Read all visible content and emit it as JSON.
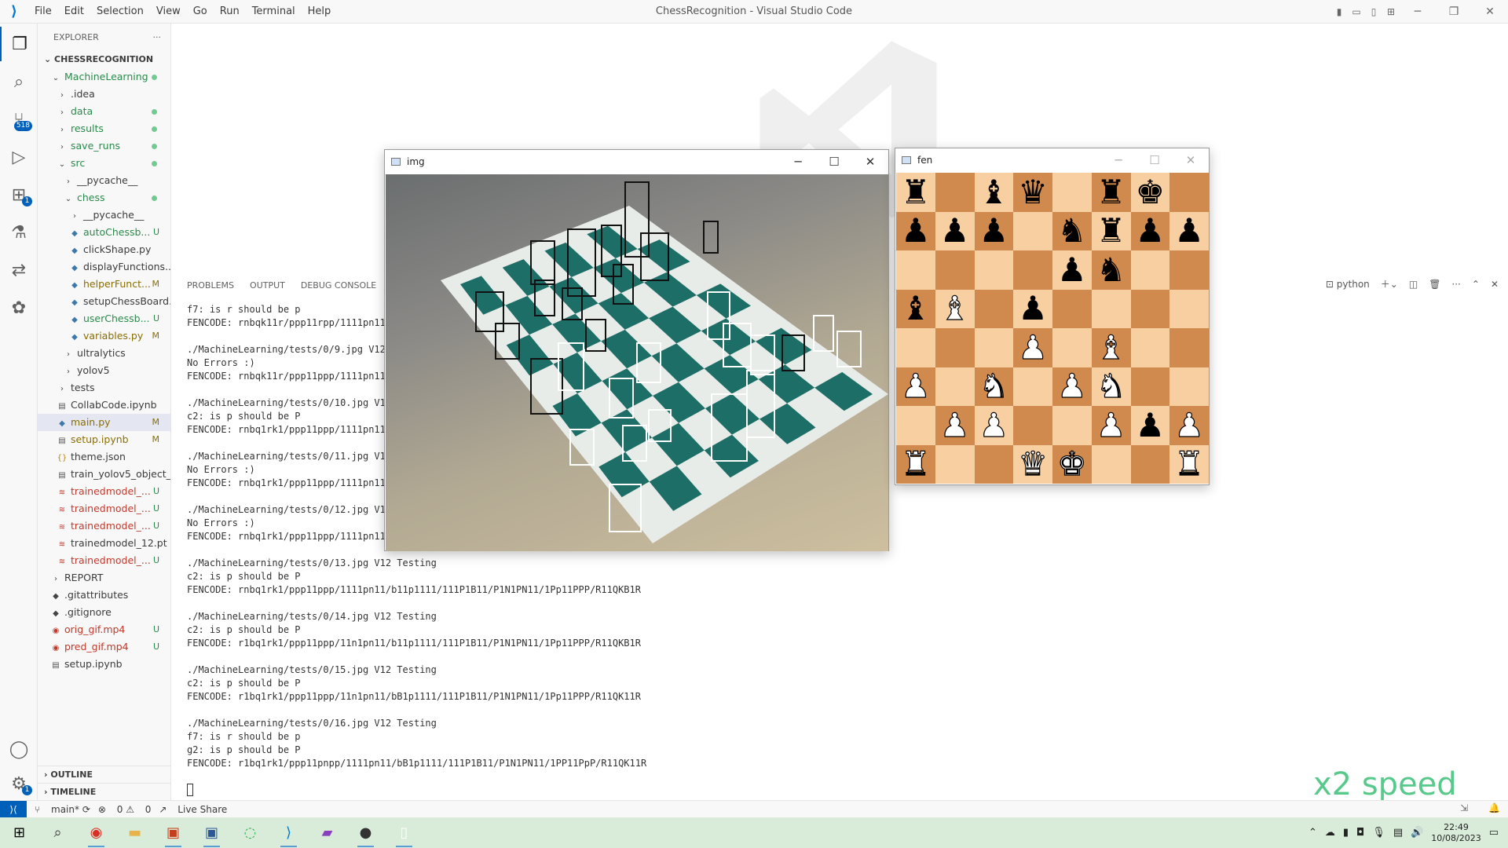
{
  "titlebar": {
    "menus": [
      "File",
      "Edit",
      "Selection",
      "View",
      "Go",
      "Run",
      "Terminal",
      "Help"
    ],
    "title": "ChessRecognition - Visual Studio Code"
  },
  "activity": {
    "scm_badge": "518",
    "ext_badge": "1",
    "settings_badge": "1"
  },
  "explorer": {
    "header": "EXPLORER",
    "root": "CHESSRECOGNITION",
    "rows": [
      {
        "label": "MachineLearning",
        "depth": 1,
        "kind": "folder-open",
        "status": "dot"
      },
      {
        "label": ".idea",
        "depth": 2,
        "kind": "folder",
        "status": ""
      },
      {
        "label": "data",
        "depth": 2,
        "kind": "folder",
        "status": "dot"
      },
      {
        "label": "results",
        "depth": 2,
        "kind": "folder",
        "status": "dot"
      },
      {
        "label": "save_runs",
        "depth": 2,
        "kind": "folder",
        "status": "dot"
      },
      {
        "label": "src",
        "depth": 2,
        "kind": "folder-open",
        "status": "dot"
      },
      {
        "label": "__pycache__",
        "depth": 3,
        "kind": "folder",
        "status": ""
      },
      {
        "label": "chess",
        "depth": 3,
        "kind": "folder-open",
        "status": "dot"
      },
      {
        "label": "__pycache__",
        "depth": 4,
        "kind": "folder",
        "status": ""
      },
      {
        "label": "autoChessb...",
        "depth": 4,
        "kind": "py",
        "status": "U"
      },
      {
        "label": "clickShape.py",
        "depth": 4,
        "kind": "py",
        "status": ""
      },
      {
        "label": "displayFunctions...",
        "depth": 4,
        "kind": "py",
        "status": ""
      },
      {
        "label": "helperFunct...",
        "depth": 4,
        "kind": "py",
        "status": "M"
      },
      {
        "label": "setupChessBoard...",
        "depth": 4,
        "kind": "py",
        "status": ""
      },
      {
        "label": "userChessb...",
        "depth": 4,
        "kind": "py",
        "status": "U"
      },
      {
        "label": "variables.py",
        "depth": 4,
        "kind": "py",
        "status": "M"
      },
      {
        "label": "ultralytics",
        "depth": 3,
        "kind": "folder",
        "status": ""
      },
      {
        "label": "yolov5",
        "depth": 3,
        "kind": "folder",
        "status": ""
      },
      {
        "label": "tests",
        "depth": 2,
        "kind": "folder",
        "status": ""
      },
      {
        "label": "CollabCode.ipynb",
        "depth": 2,
        "kind": "nb",
        "status": ""
      },
      {
        "label": "main.py",
        "depth": 2,
        "kind": "py",
        "status": "M",
        "selected": true
      },
      {
        "label": "setup.ipynb",
        "depth": 2,
        "kind": "nb",
        "status": "M"
      },
      {
        "label": "theme.json",
        "depth": 2,
        "kind": "json",
        "status": ""
      },
      {
        "label": "train_yolov5_object_...",
        "depth": 2,
        "kind": "nb",
        "status": ""
      },
      {
        "label": "trainedmodel_...",
        "depth": 2,
        "kind": "pt",
        "status": "U"
      },
      {
        "label": "trainedmodel_...",
        "depth": 2,
        "kind": "pt",
        "status": "U"
      },
      {
        "label": "trainedmodel_...",
        "depth": 2,
        "kind": "pt",
        "status": "U"
      },
      {
        "label": "trainedmodel_12.pt",
        "depth": 2,
        "kind": "pt",
        "status": ""
      },
      {
        "label": "trainedmodel_...",
        "depth": 2,
        "kind": "pt",
        "status": "U"
      },
      {
        "label": "REPORT",
        "depth": 1,
        "kind": "folder",
        "status": ""
      },
      {
        "label": ".gitattributes",
        "depth": 1,
        "kind": "git",
        "status": ""
      },
      {
        "label": ".gitignore",
        "depth": 1,
        "kind": "git",
        "status": ""
      },
      {
        "label": "orig_gif.mp4",
        "depth": 1,
        "kind": "mp4",
        "status": "U"
      },
      {
        "label": "pred_gif.mp4",
        "depth": 1,
        "kind": "mp4",
        "status": "U"
      },
      {
        "label": "setup.ipynb",
        "depth": 1,
        "kind": "nb",
        "status": ""
      }
    ],
    "outline": "OUTLINE",
    "timeline": "TIMELINE"
  },
  "panel": {
    "tabs": [
      "PROBLEMS",
      "OUTPUT",
      "DEBUG CONSOLE"
    ],
    "shell": "python"
  },
  "terminal": {
    "lines": [
      "f7: is r should be p",
      "FENCODE: rnbqk11r/ppp11rpp/1111pn11/",
      "",
      "./MachineLearning/tests/0/9.jpg V12",
      "No Errors :)",
      "FENCODE: rnbqk11r/ppp11ppp/1111pn11/",
      "",
      "./MachineLearning/tests/0/10.jpg V12",
      "c2: is p should be P",
      "FENCODE: rnbq1rk1/ppp11ppp/1111pn11/",
      "",
      "./MachineLearning/tests/0/11.jpg V12",
      "No Errors :)",
      "FENCODE: rnbq1rk1/ppp11ppp/1111pn11/",
      "",
      "./MachineLearning/tests/0/12.jpg V12",
      "No Errors :)",
      "FENCODE: rnbq1rk1/ppp11ppp/1111pn11/",
      "",
      "./MachineLearning/tests/0/13.jpg V12 Testing",
      "c2: is p should be P",
      "FENCODE: rnbq1rk1/ppp11ppp/1111pn11/b11p1111/111P1B11/P1N1PN11/1Pp11PPP/R11QKB1R",
      "",
      "./MachineLearning/tests/0/14.jpg V12 Testing",
      "c2: is p should be P",
      "FENCODE: r1bq1rk1/ppp11ppp/11n1pn11/b11p1111/111P1B11/P1N1PN11/1Pp11PPP/R11QKB1R",
      "",
      "./MachineLearning/tests/0/15.jpg V12 Testing",
      "c2: is p should be P",
      "FENCODE: r1bq1rk1/ppp11ppp/11n1pn11/bB1p1111/111P1B11/P1N1PN11/1Pp11PPP/R11QK11R",
      "",
      "./MachineLearning/tests/0/16.jpg V12 Testing",
      "f7: is r should be p",
      "g2: is p should be P",
      "FENCODE: r1bq1rk1/ppp11pnpp/1111pn11/bB1p1111/111P1B11/P1N1PN11/1PP11PpP/R11QK11R"
    ]
  },
  "status": {
    "branch": "main*",
    "errors": "0",
    "warnings": "0",
    "liveshare": "Live Share"
  },
  "img_window": {
    "title": "img"
  },
  "fen_window": {
    "title": "fen",
    "board": [
      [
        "r",
        "",
        "b",
        "q",
        "",
        "r",
        "k",
        ""
      ],
      [
        "p",
        "p",
        "p",
        "",
        "n",
        "r",
        "p",
        "p"
      ],
      [
        "",
        "",
        "",
        "",
        "p",
        "n",
        "",
        ""
      ],
      [
        "b",
        "B",
        "",
        "p",
        "",
        "",
        "",
        ""
      ],
      [
        "",
        "",
        "",
        "P",
        "",
        "B",
        "",
        ""
      ],
      [
        "P",
        "",
        "N",
        "",
        "P",
        "N",
        "",
        ""
      ],
      [
        "",
        "P",
        "P",
        "",
        "",
        "P",
        "p",
        "P"
      ],
      [
        "R",
        "",
        "",
        "Q",
        "K",
        "",
        "",
        "R"
      ]
    ]
  },
  "overlay": {
    "speed": "x2 speed"
  },
  "clock": {
    "time": "22:49",
    "date": "10/08/2023"
  }
}
